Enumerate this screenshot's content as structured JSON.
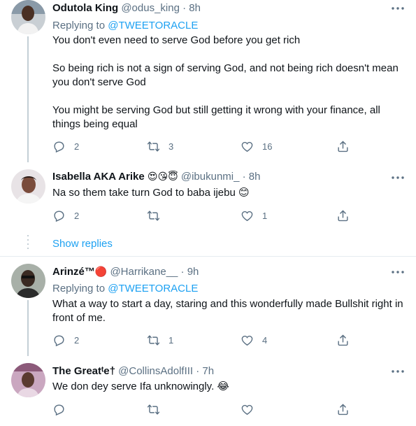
{
  "tweets": [
    {
      "name": "Odutola King",
      "name_emoji": "",
      "handle": "@odus_king · 8h",
      "replying_prefix": "Replying to ",
      "replying_mention": "@TWEETORACLE",
      "body": "You don't even need to serve God before you get rich\n\nSo being rich is not a sign of serving God, and not being rich doesn't mean you don't serve God\n\nYou might be serving God but still getting it wrong with your finance, all things being equal",
      "replies": "2",
      "retweets": "3",
      "likes": "16"
    },
    {
      "name": "Isabella AKA Arike",
      "name_emoji": "😍😘😇",
      "handle": "@ibukunmi_ · 8h",
      "body": "Na so them take turn God to baba ijebu 😊",
      "replies": "2",
      "retweets": "",
      "likes": "1",
      "show_replies": "Show replies"
    },
    {
      "name": "Arinzé™",
      "name_emoji": "🔴",
      "handle": "@Harrikane__ · 9h",
      "replying_prefix": "Replying to ",
      "replying_mention": "@TWEETORACLE",
      "body": "What a way to start a day, staring and this wonderfully made Bullshit right in front of me.",
      "replies": "2",
      "retweets": "1",
      "likes": "4"
    },
    {
      "name": "The Great",
      "name_emoji": "",
      "name_suffix": "e",
      "name_dagger": "ᵗ",
      "name_dagger2": "†",
      "handle": "@CollinsAdolfIII · 7h",
      "body": "We don dey serve Ifa unknowingly. 😂",
      "replies": "",
      "retweets": "",
      "likes": ""
    }
  ],
  "colors": {
    "text": "#0f1419",
    "secondary": "#5b7083",
    "link": "#1da1f2",
    "divider": "#e6ecf0"
  },
  "icons": [
    "reply-icon",
    "retweet-icon",
    "like-icon",
    "share-icon",
    "more-icon"
  ]
}
